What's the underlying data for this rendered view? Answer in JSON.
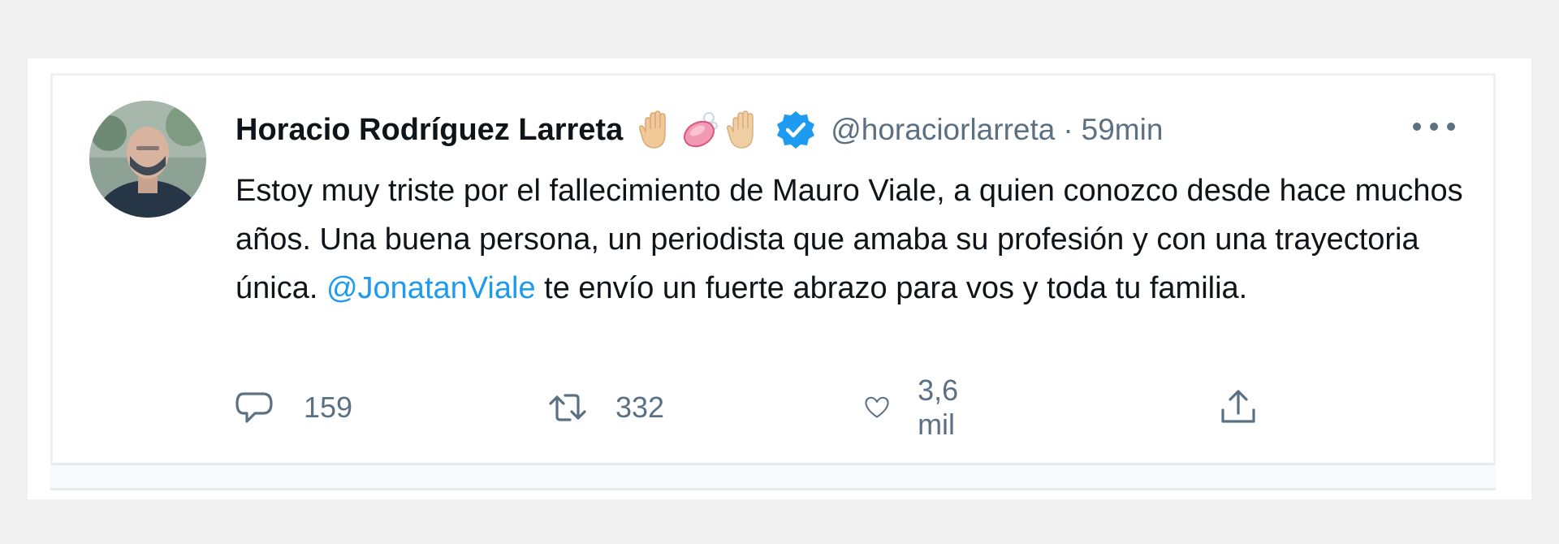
{
  "tweet": {
    "author": {
      "name": "Horacio Rodríguez Larreta",
      "handle": "@horaciorlarreta",
      "verified": true,
      "avatar_icon": "avatar-person-mask"
    },
    "emojis": [
      "raised-hand-emoji",
      "soap-emoji",
      "raised-hand-emoji"
    ],
    "separator": "·",
    "time": "59min",
    "text_parts": {
      "before": "Estoy muy triste por el fallecimiento de Mauro Viale, a quien conozco desde hace muchos años. Una buena persona, un periodista que amaba su profesión y con una trayectoria única. ",
      "mention": "@JonatanViale",
      "after": " te envío un fuerte abrazo para vos y toda tu familia."
    },
    "actions": {
      "reply_count": "159",
      "retweet_count": "332",
      "like_count": "3,6 mil"
    }
  },
  "colors": {
    "accent": "#1d9bf0",
    "secondary_text": "#5b7083",
    "primary_text": "#0f1419",
    "background": "#f0f0f0"
  }
}
